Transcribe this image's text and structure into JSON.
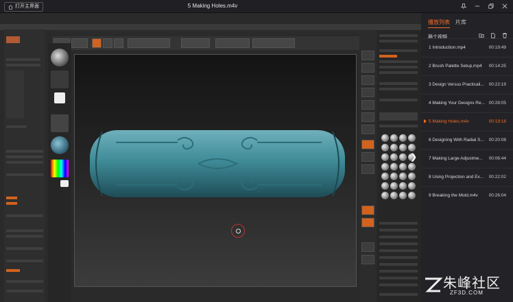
{
  "titlebar": {
    "home_label": "打开主界面",
    "title": "5 Making Holes.m4v"
  },
  "playlist": {
    "tabs": [
      "播放列表",
      "片库"
    ],
    "active_tab": 0,
    "header_label": "两个视频",
    "items": [
      {
        "title": "1 Introduction.mp4",
        "duration": "00:19:49"
      },
      {
        "title": "2 Brush Palette Setup.mp4",
        "duration": "00:14:25"
      },
      {
        "title": "3 Design Versus Practicali...",
        "duration": "00:22:19"
      },
      {
        "title": "4 Making Your Designs Re...",
        "duration": "00:28:05"
      },
      {
        "title": "5 Making Holes.m4v",
        "duration": "00:19:18"
      },
      {
        "title": "6 Designing With Radial S...",
        "duration": "00:20:08"
      },
      {
        "title": "7 Making Large Adjustme...",
        "duration": "00:06:44"
      },
      {
        "title": "8 Using Projection and Ex...",
        "duration": "00:22:02"
      },
      {
        "title": "9 Breaking the Mold.m4v",
        "duration": "00:26:04"
      }
    ],
    "active_index": 4
  },
  "watermark": {
    "text": "朱峰社区",
    "url": "ZF3D.COM"
  },
  "colors": {
    "accent": "#f26b28",
    "model": "#3f8c98"
  }
}
